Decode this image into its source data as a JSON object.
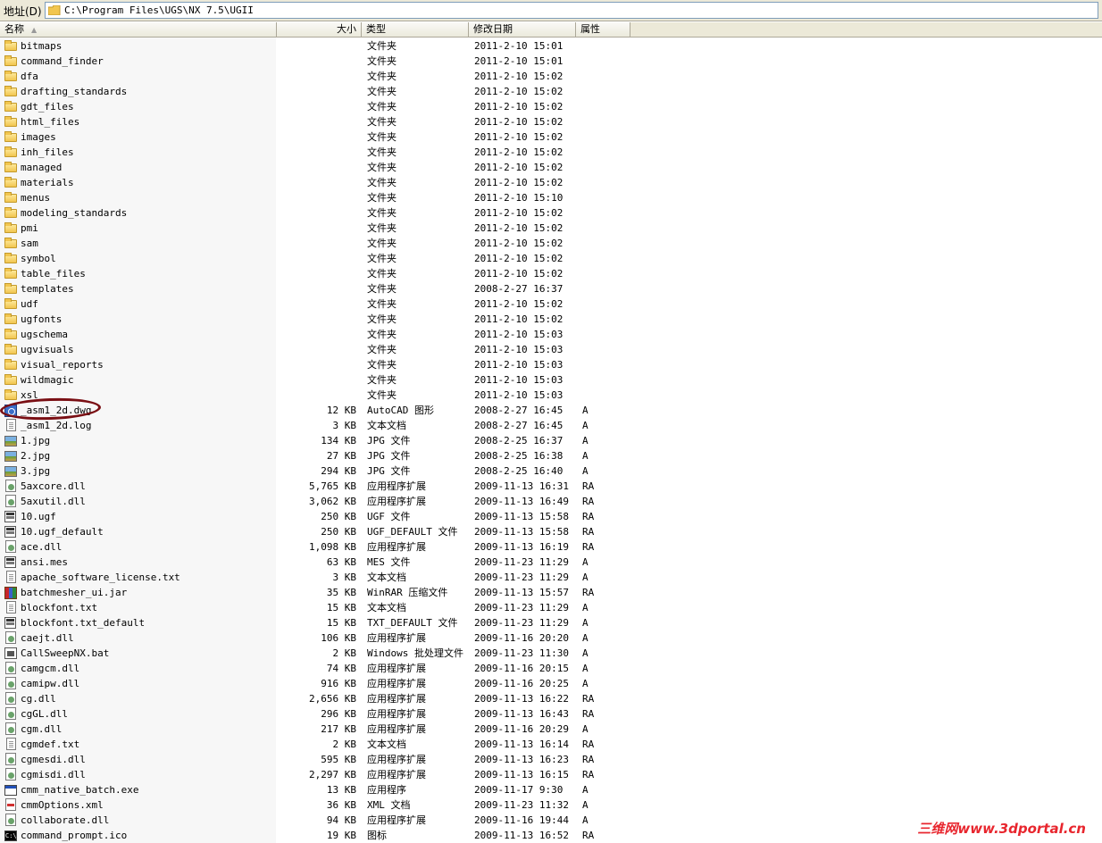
{
  "address": {
    "label": "地址(D)",
    "path": "C:\\Program Files\\UGS\\NX 7.5\\UGII"
  },
  "columns": {
    "name": "名称",
    "size": "大小",
    "type": "类型",
    "date": "修改日期",
    "attr": "属性"
  },
  "files": [
    {
      "name": "bitmaps",
      "size": "",
      "type": "文件夹",
      "date": "2011-2-10 15:01",
      "attr": "",
      "icon": "folder"
    },
    {
      "name": "command_finder",
      "size": "",
      "type": "文件夹",
      "date": "2011-2-10 15:01",
      "attr": "",
      "icon": "folder"
    },
    {
      "name": "dfa",
      "size": "",
      "type": "文件夹",
      "date": "2011-2-10 15:02",
      "attr": "",
      "icon": "folder"
    },
    {
      "name": "drafting_standards",
      "size": "",
      "type": "文件夹",
      "date": "2011-2-10 15:02",
      "attr": "",
      "icon": "folder"
    },
    {
      "name": "gdt_files",
      "size": "",
      "type": "文件夹",
      "date": "2011-2-10 15:02",
      "attr": "",
      "icon": "folder"
    },
    {
      "name": "html_files",
      "size": "",
      "type": "文件夹",
      "date": "2011-2-10 15:02",
      "attr": "",
      "icon": "folder"
    },
    {
      "name": "images",
      "size": "",
      "type": "文件夹",
      "date": "2011-2-10 15:02",
      "attr": "",
      "icon": "folder"
    },
    {
      "name": "inh_files",
      "size": "",
      "type": "文件夹",
      "date": "2011-2-10 15:02",
      "attr": "",
      "icon": "folder"
    },
    {
      "name": "managed",
      "size": "",
      "type": "文件夹",
      "date": "2011-2-10 15:02",
      "attr": "",
      "icon": "folder"
    },
    {
      "name": "materials",
      "size": "",
      "type": "文件夹",
      "date": "2011-2-10 15:02",
      "attr": "",
      "icon": "folder"
    },
    {
      "name": "menus",
      "size": "",
      "type": "文件夹",
      "date": "2011-2-10 15:10",
      "attr": "",
      "icon": "folder"
    },
    {
      "name": "modeling_standards",
      "size": "",
      "type": "文件夹",
      "date": "2011-2-10 15:02",
      "attr": "",
      "icon": "folder"
    },
    {
      "name": "pmi",
      "size": "",
      "type": "文件夹",
      "date": "2011-2-10 15:02",
      "attr": "",
      "icon": "folder"
    },
    {
      "name": "sam",
      "size": "",
      "type": "文件夹",
      "date": "2011-2-10 15:02",
      "attr": "",
      "icon": "folder"
    },
    {
      "name": "symbol",
      "size": "",
      "type": "文件夹",
      "date": "2011-2-10 15:02",
      "attr": "",
      "icon": "folder"
    },
    {
      "name": "table_files",
      "size": "",
      "type": "文件夹",
      "date": "2011-2-10 15:02",
      "attr": "",
      "icon": "folder"
    },
    {
      "name": "templates",
      "size": "",
      "type": "文件夹",
      "date": "2008-2-27 16:37",
      "attr": "",
      "icon": "folder"
    },
    {
      "name": "udf",
      "size": "",
      "type": "文件夹",
      "date": "2011-2-10 15:02",
      "attr": "",
      "icon": "folder"
    },
    {
      "name": "ugfonts",
      "size": "",
      "type": "文件夹",
      "date": "2011-2-10 15:02",
      "attr": "",
      "icon": "folder"
    },
    {
      "name": "ugschema",
      "size": "",
      "type": "文件夹",
      "date": "2011-2-10 15:03",
      "attr": "",
      "icon": "folder"
    },
    {
      "name": "ugvisuals",
      "size": "",
      "type": "文件夹",
      "date": "2011-2-10 15:03",
      "attr": "",
      "icon": "folder"
    },
    {
      "name": "visual_reports",
      "size": "",
      "type": "文件夹",
      "date": "2011-2-10 15:03",
      "attr": "",
      "icon": "folder"
    },
    {
      "name": "wildmagic",
      "size": "",
      "type": "文件夹",
      "date": "2011-2-10 15:03",
      "attr": "",
      "icon": "folder"
    },
    {
      "name": "xsl",
      "size": "",
      "type": "文件夹",
      "date": "2011-2-10 15:03",
      "attr": "",
      "icon": "folder"
    },
    {
      "name": "_asm1_2d.dwg",
      "size": "12 KB",
      "type": "AutoCAD 图形",
      "date": "2008-2-27 16:45",
      "attr": "A",
      "icon": "cad"
    },
    {
      "name": "_asm1_2d.log",
      "size": "3 KB",
      "type": "文本文档",
      "date": "2008-2-27 16:45",
      "attr": "A",
      "icon": "file"
    },
    {
      "name": "1.jpg",
      "size": "134 KB",
      "type": "JPG 文件",
      "date": "2008-2-25 16:37",
      "attr": "A",
      "icon": "img"
    },
    {
      "name": "2.jpg",
      "size": "27 KB",
      "type": "JPG 文件",
      "date": "2008-2-25 16:38",
      "attr": "A",
      "icon": "img"
    },
    {
      "name": "3.jpg",
      "size": "294 KB",
      "type": "JPG 文件",
      "date": "2008-2-25 16:40",
      "attr": "A",
      "icon": "img"
    },
    {
      "name": "5axcore.dll",
      "size": "5,765 KB",
      "type": "应用程序扩展",
      "date": "2009-11-13 16:31",
      "attr": "RA",
      "icon": "dll"
    },
    {
      "name": "5axutil.dll",
      "size": "3,062 KB",
      "type": "应用程序扩展",
      "date": "2009-11-13 16:49",
      "attr": "RA",
      "icon": "dll"
    },
    {
      "name": "10.ugf",
      "size": "250 KB",
      "type": "UGF 文件",
      "date": "2009-11-13 15:58",
      "attr": "RA",
      "icon": "mes"
    },
    {
      "name": "10.ugf_default",
      "size": "250 KB",
      "type": "UGF_DEFAULT 文件",
      "date": "2009-11-13 15:58",
      "attr": "RA",
      "icon": "mes"
    },
    {
      "name": "ace.dll",
      "size": "1,098 KB",
      "type": "应用程序扩展",
      "date": "2009-11-13 16:19",
      "attr": "RA",
      "icon": "dll"
    },
    {
      "name": "ansi.mes",
      "size": "63 KB",
      "type": "MES 文件",
      "date": "2009-11-23 11:29",
      "attr": "A",
      "icon": "mes"
    },
    {
      "name": "apache_software_license.txt",
      "size": "3 KB",
      "type": "文本文档",
      "date": "2009-11-23 11:29",
      "attr": "A",
      "icon": "file"
    },
    {
      "name": "batchmesher_ui.jar",
      "size": "35 KB",
      "type": "WinRAR 压缩文件",
      "date": "2009-11-13 15:57",
      "attr": "RA",
      "icon": "jar"
    },
    {
      "name": "blockfont.txt",
      "size": "15 KB",
      "type": "文本文档",
      "date": "2009-11-23 11:29",
      "attr": "A",
      "icon": "file"
    },
    {
      "name": "blockfont.txt_default",
      "size": "15 KB",
      "type": "TXT_DEFAULT 文件",
      "date": "2009-11-23 11:29",
      "attr": "A",
      "icon": "mes"
    },
    {
      "name": "caejt.dll",
      "size": "106 KB",
      "type": "应用程序扩展",
      "date": "2009-11-16 20:20",
      "attr": "A",
      "icon": "dll"
    },
    {
      "name": "CallSweepNX.bat",
      "size": "2 KB",
      "type": "Windows 批处理文件",
      "date": "2009-11-23 11:30",
      "attr": "A",
      "icon": "bat"
    },
    {
      "name": "camgcm.dll",
      "size": "74 KB",
      "type": "应用程序扩展",
      "date": "2009-11-16 20:15",
      "attr": "A",
      "icon": "dll"
    },
    {
      "name": "camipw.dll",
      "size": "916 KB",
      "type": "应用程序扩展",
      "date": "2009-11-16 20:25",
      "attr": "A",
      "icon": "dll"
    },
    {
      "name": "cg.dll",
      "size": "2,656 KB",
      "type": "应用程序扩展",
      "date": "2009-11-13 16:22",
      "attr": "RA",
      "icon": "dll"
    },
    {
      "name": "cgGL.dll",
      "size": "296 KB",
      "type": "应用程序扩展",
      "date": "2009-11-13 16:43",
      "attr": "RA",
      "icon": "dll"
    },
    {
      "name": "cgm.dll",
      "size": "217 KB",
      "type": "应用程序扩展",
      "date": "2009-11-16 20:29",
      "attr": "A",
      "icon": "dll"
    },
    {
      "name": "cgmdef.txt",
      "size": "2 KB",
      "type": "文本文档",
      "date": "2009-11-13 16:14",
      "attr": "RA",
      "icon": "file"
    },
    {
      "name": "cgmesdi.dll",
      "size": "595 KB",
      "type": "应用程序扩展",
      "date": "2009-11-13 16:23",
      "attr": "RA",
      "icon": "dll"
    },
    {
      "name": "cgmisdi.dll",
      "size": "2,297 KB",
      "type": "应用程序扩展",
      "date": "2009-11-13 16:15",
      "attr": "RA",
      "icon": "dll"
    },
    {
      "name": "cmm_native_batch.exe",
      "size": "13 KB",
      "type": "应用程序",
      "date": "2009-11-17 9:30",
      "attr": "A",
      "icon": "app"
    },
    {
      "name": "cmmOptions.xml",
      "size": "36 KB",
      "type": "XML 文档",
      "date": "2009-11-23 11:32",
      "attr": "A",
      "icon": "xml"
    },
    {
      "name": "collaborate.dll",
      "size": "94 KB",
      "type": "应用程序扩展",
      "date": "2009-11-16 19:44",
      "attr": "A",
      "icon": "dll"
    },
    {
      "name": "command_prompt.ico",
      "size": "19 KB",
      "type": "图标",
      "date": "2009-11-13 16:52",
      "attr": "RA",
      "icon": "cmd"
    }
  ],
  "watermark": "三维网www.3dportal.cn"
}
